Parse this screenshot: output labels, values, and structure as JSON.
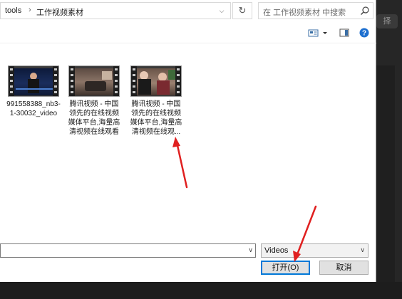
{
  "address": {
    "crumbs": [
      "tools",
      "工作视频素材"
    ],
    "separator": "›"
  },
  "search": {
    "placeholder": "在 工作视频素材 中搜索"
  },
  "background_app": {
    "button_label": "择"
  },
  "files": [
    {
      "name": "991558388_nb3-1-30032_video"
    },
    {
      "name": "腾讯视频 - 中国领先的在线视频媒体平台,海量高清视频在线观看"
    },
    {
      "name": "腾讯视频 - 中国领先的在线视频媒体平台,海量高清视频在线观..."
    }
  ],
  "filename": {
    "value": ""
  },
  "file_type": {
    "selected": "Videos"
  },
  "buttons": {
    "open": "打开(O)",
    "cancel": "取消"
  },
  "colors": {
    "accent": "#0078d7",
    "arrow": "#e02020"
  }
}
